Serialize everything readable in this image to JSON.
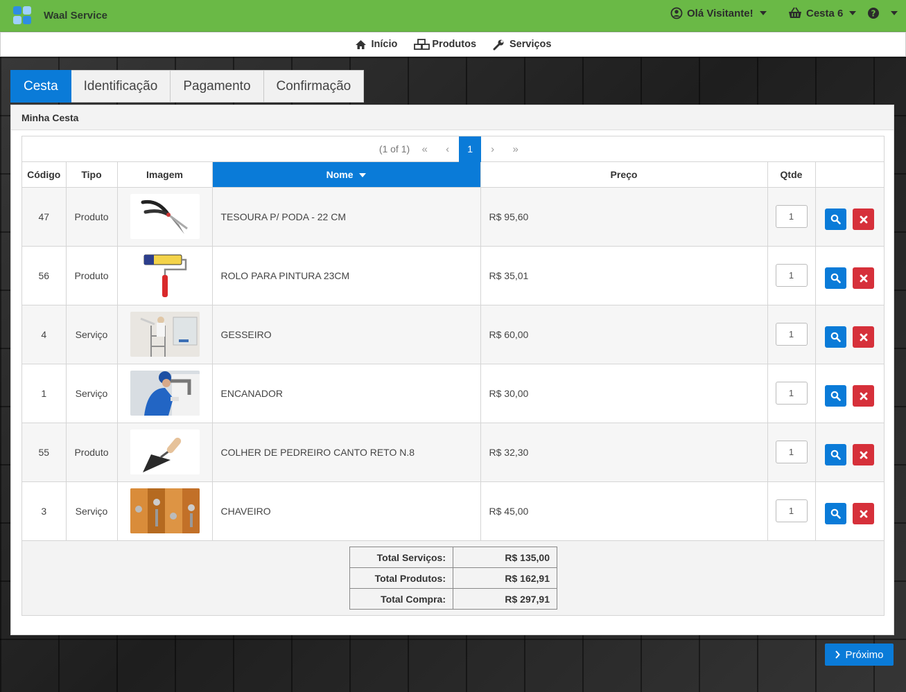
{
  "app": {
    "brand": "Waal Service"
  },
  "topbar": {
    "user_label": "Olá Visitante!",
    "cart_label": "Cesta 6"
  },
  "nav": [
    {
      "label": "Início",
      "icon": "home-icon"
    },
    {
      "label": "Produtos",
      "icon": "cubes-icon"
    },
    {
      "label": "Serviços",
      "icon": "wrench-icon"
    }
  ],
  "tabs": [
    "Cesta",
    "Identificação",
    "Pagamento",
    "Confirmação"
  ],
  "panel": {
    "title": "Minha Cesta"
  },
  "pager": {
    "info": "(1 of 1)",
    "current": "1"
  },
  "columns": {
    "code": "Código",
    "type": "Tipo",
    "image": "Imagem",
    "name": "Nome",
    "price": "Preço",
    "qty": "Qtde"
  },
  "items": [
    {
      "code": "47",
      "type": "Produto",
      "name": "TESOURA P/ PODA - 22 CM",
      "price": "R$ 95,60",
      "qty": "1",
      "image": "pruning-shears"
    },
    {
      "code": "56",
      "type": "Produto",
      "name": "ROLO PARA PINTURA 23CM",
      "price": "R$ 35,01",
      "qty": "1",
      "image": "paint-roller"
    },
    {
      "code": "4",
      "type": "Serviço",
      "name": "GESSEIRO",
      "price": "R$ 60,00",
      "qty": "1",
      "image": "plasterer-photo"
    },
    {
      "code": "1",
      "type": "Serviço",
      "name": "ENCANADOR",
      "price": "R$ 30,00",
      "qty": "1",
      "image": "plumber-photo"
    },
    {
      "code": "55",
      "type": "Produto",
      "name": "COLHER DE PEDREIRO CANTO RETO N.8",
      "price": "R$ 32,30",
      "qty": "1",
      "image": "trowel"
    },
    {
      "code": "3",
      "type": "Serviço",
      "name": "CHAVEIRO",
      "price": "R$ 45,00",
      "qty": "1",
      "image": "locksmith-photo"
    }
  ],
  "totals": [
    {
      "label": "Total Serviços:",
      "value": "R$ 135,00"
    },
    {
      "label": "Total Produtos:",
      "value": "R$ 162,91"
    },
    {
      "label": "Total Compra:",
      "value": "R$ 297,91"
    }
  ],
  "next_label": "Próximo",
  "colors": {
    "green": "#6ab946",
    "blue": "#0a7bd8",
    "red": "#d6303a"
  }
}
